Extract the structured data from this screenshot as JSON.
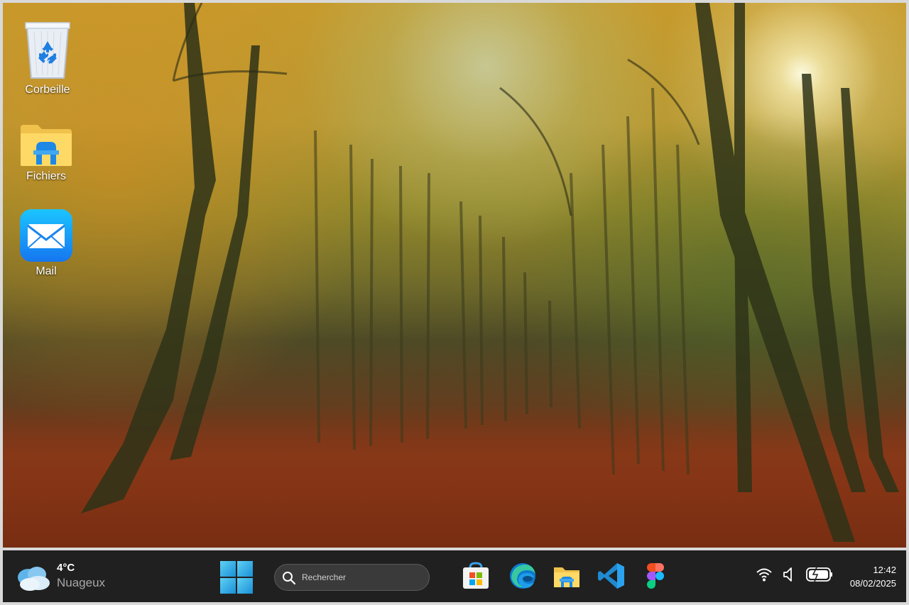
{
  "desktop": {
    "icons": [
      {
        "label": "Corbeille",
        "icon": "recycle-bin-icon"
      },
      {
        "label": "Fichiers",
        "icon": "folder-icon"
      },
      {
        "label": "Mail",
        "icon": "mail-icon"
      }
    ]
  },
  "taskbar": {
    "weather": {
      "temperature": "4°C",
      "condition": "Nuageux",
      "icon": "cloud-icon"
    },
    "start_icon": "windows-start-icon",
    "search": {
      "placeholder": "Rechercher",
      "icon": "search-icon"
    },
    "pinned_apps": [
      {
        "name": "microsoft-store-icon"
      },
      {
        "name": "edge-icon"
      },
      {
        "name": "file-explorer-icon"
      },
      {
        "name": "vscode-icon"
      },
      {
        "name": "figma-icon"
      }
    ],
    "tray": {
      "icons": [
        "wifi-icon",
        "volume-icon",
        "battery-icon"
      ]
    },
    "clock": {
      "time": "12:42",
      "date": "08/02/2025"
    }
  },
  "colors": {
    "taskbar_bg": "#202020",
    "accent_blue": "#0078d4",
    "frame_border": "#d9d9d9"
  }
}
